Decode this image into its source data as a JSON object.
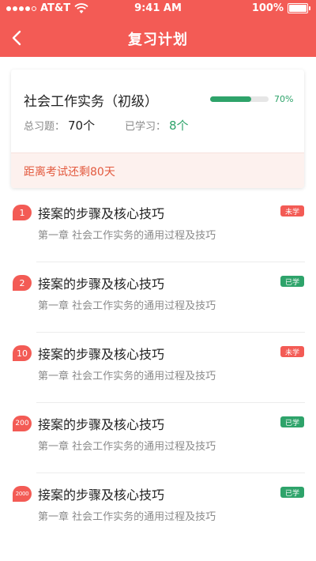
{
  "status_bar": {
    "carrier": "AT&T",
    "time": "9:41 AM",
    "battery": "100%"
  },
  "header": {
    "title": "复习计划",
    "back_icon": "chevron-left-icon"
  },
  "summary_card": {
    "course_title": "社会工作实务（初级）",
    "progress_percent": 70,
    "progress_label": "70%",
    "total_label": "总习题：",
    "total_value": "70个",
    "learned_label": "已学习：",
    "learned_value": "8个",
    "countdown_text": "距离考试还剩80天"
  },
  "colors": {
    "accent": "#f35b55",
    "learned": "#2ea36a",
    "countdown": "#e35a3f"
  },
  "items": [
    {
      "number": "1",
      "title": "接案的步骤及核心技巧",
      "subtitle": "第一章 社会工作实务的通用过程及技巧",
      "tag": "未学",
      "learned": false
    },
    {
      "number": "2",
      "title": "接案的步骤及核心技巧",
      "subtitle": "第一章 社会工作实务的通用过程及技巧",
      "tag": "已学",
      "learned": true
    },
    {
      "number": "10",
      "title": "接案的步骤及核心技巧",
      "subtitle": "第一章 社会工作实务的通用过程及技巧",
      "tag": "未学",
      "learned": false
    },
    {
      "number": "200",
      "title": "接案的步骤及核心技巧",
      "subtitle": "第一章 社会工作实务的通用过程及技巧",
      "tag": "已学",
      "learned": true
    },
    {
      "number": "2000",
      "title": "接案的步骤及核心技巧",
      "subtitle": "第一章 社会工作实务的通用过程及技巧",
      "tag": "已学",
      "learned": true
    }
  ]
}
